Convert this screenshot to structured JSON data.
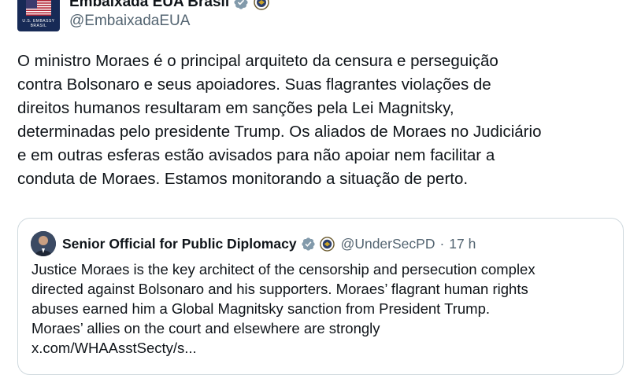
{
  "author": {
    "display_name": "Embaixada EUA Brasil",
    "handle": "@EmbaixadaEUA",
    "avatar_caption": "U.S. EMBASSY",
    "avatar_caption_sub": "BRASIL"
  },
  "tweet": {
    "lines": [
      "O ministro Moraes é o principal arquiteto da censura e perseguição",
      "contra Bolsonaro e seus apoiadores. Suas flagrantes violações de",
      "direitos humanos resultaram em sanções pela Lei Magnitsky,",
      "determinadas pelo presidente Trump. Os aliados de Moraes no Judiciário",
      "e em outras esferas estão avisados para não apoiar nem facilitar a",
      "conduta de Moraes. Estamos monitorando a situação de perto."
    ]
  },
  "quoted": {
    "display_name": "Senior Official for Public Diplomacy",
    "handle": "@UnderSecPD",
    "separator": "·",
    "time": "17 h",
    "lines": [
      "Justice Moraes is the key architect of the censorship and persecution complex",
      "directed against Bolsonaro and his supporters. Moraes’ flagrant human rights",
      "abuses earned him a Global Magnitsky sanction from President Trump.",
      "Moraes’ allies on the court and elsewhere are strongly",
      "x.com/WHAAsstSecty/s..."
    ]
  },
  "icons": {
    "verified": "gray-verified-badge-icon",
    "seal": "us-government-seal-icon"
  },
  "colors": {
    "text": "#0f1419",
    "secondary": "#536471",
    "border": "#cfd9de",
    "badge": "#829aab",
    "avatar_bg": "#172a56"
  }
}
